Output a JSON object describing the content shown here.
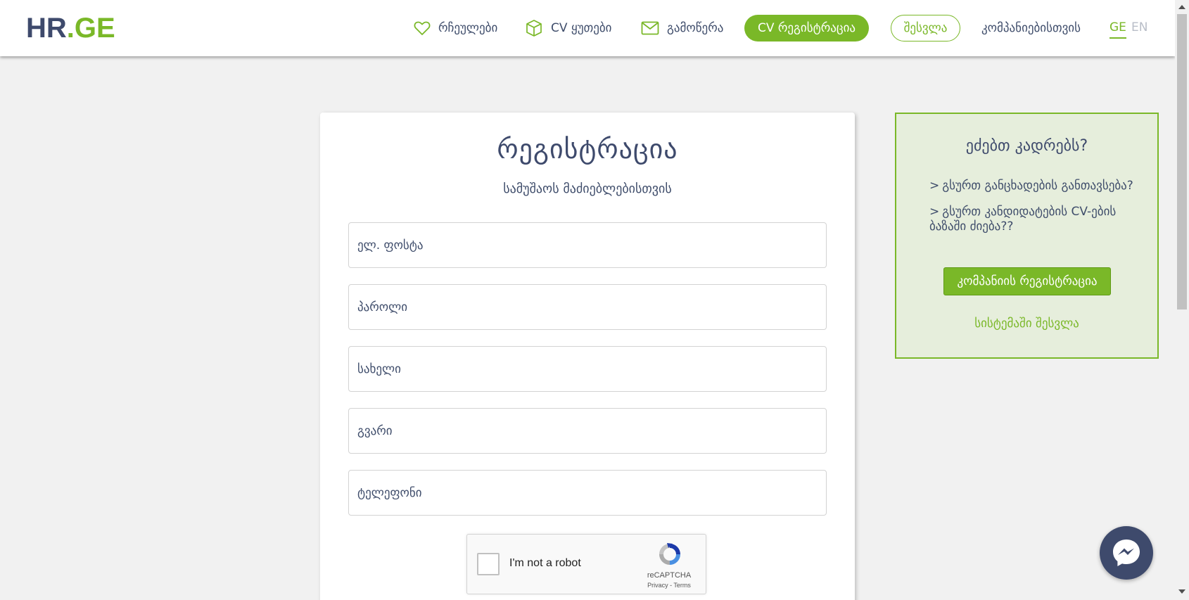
{
  "header": {
    "logo": {
      "part1": "HR",
      "dot": ".",
      "part2": "GE"
    },
    "nav": [
      {
        "label": "რჩეულები",
        "icon": "heart-icon"
      },
      {
        "label": "CV ყუთები",
        "icon": "box-icon"
      },
      {
        "label": "გამოწერა",
        "icon": "envelope-icon"
      }
    ],
    "cv_register": "CV რეგისტრაცია",
    "login": "შესვლა",
    "for_companies": "კომპანიებისთვის",
    "lang_ge": "GE",
    "lang_en": "EN"
  },
  "form": {
    "title": "რეგისტრაცია",
    "subtitle": "სამუშაოს მაძიებლებისთვის",
    "fields": {
      "email": "ელ. ფოსტა",
      "password": "პაროლი",
      "first_name": "სახელი",
      "last_name": "გვარი",
      "phone": "ტელეფონი"
    },
    "captcha": {
      "label": "I'm not a robot",
      "brand": "reCAPTCHA",
      "links": "Privacy - Terms"
    }
  },
  "side": {
    "title": "ეძებთ კადრებს?",
    "items": [
      "გსურთ განცხადების განთავსება?",
      "გსურთ კანდიდატების CV-ების ბაზაში ძიება??"
    ],
    "chevron": ">",
    "register_company": "კომპანიის რეგისტრაცია",
    "system_login": "სისტემაში შესვლა"
  },
  "colors": {
    "accent": "#7ab828",
    "navy": "#3e4a6c",
    "panel_bg": "#e6eedc",
    "page_bg": "#f1f1f1"
  }
}
